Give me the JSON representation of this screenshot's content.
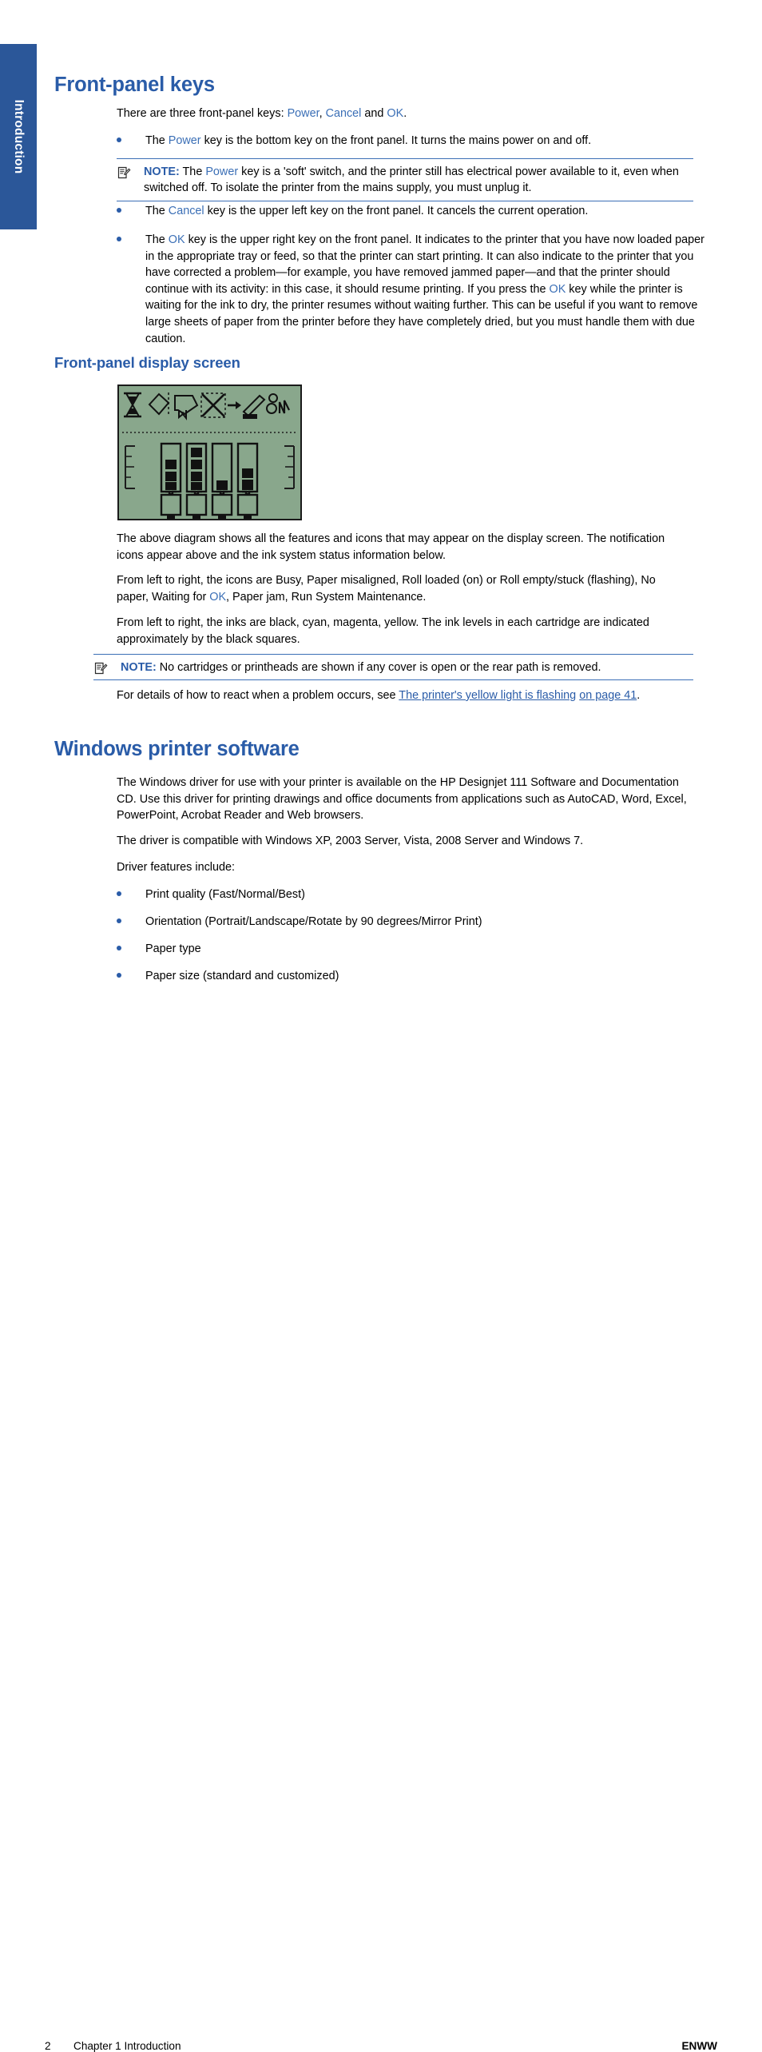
{
  "side_tab": {
    "label": "Introduction"
  },
  "sections": {
    "front_panel_keys": {
      "heading": "Front-panel keys",
      "intro_pre": "There are three front-panel keys: ",
      "intro_power": "Power",
      "intro_comma": ", ",
      "intro_cancel": "Cancel",
      "intro_and": " and ",
      "intro_ok": "OK",
      "intro_end": ".",
      "bullet_power_pre": "The ",
      "bullet_power_key": "Power",
      "bullet_power_post": " key is the bottom key on the front panel. It turns the mains power on and off.",
      "note1_label": "NOTE:",
      "note1_pre": "   The ",
      "note1_key": "Power",
      "note1_post": " key is a 'soft' switch, and the printer still has electrical power available to it, even when switched off. To isolate the printer from the mains supply, you must unplug it.",
      "bullet_cancel_pre": "The ",
      "bullet_cancel_key": "Cancel",
      "bullet_cancel_post": " key is the upper left key on the front panel. It cancels the current operation.",
      "bullet_ok_pre": "The ",
      "bullet_ok_key1": "OK",
      "bullet_ok_mid": " key is the upper right key on the front panel. It indicates to the printer that you have now loaded paper in the appropriate tray or feed, so that the printer can start printing. It can also indicate to the printer that you have corrected a problem—for example, you have removed jammed paper—and that the printer should continue with its activity: in this case, it should resume printing. If you press the ",
      "bullet_ok_key2": "OK",
      "bullet_ok_post": " key while the printer is waiting for the ink to dry, the printer resumes without waiting further. This can be useful if you want to remove large sheets of paper from the printer before they have completely dried, but you must handle them with due caution."
    },
    "front_panel_display": {
      "heading": "Front-panel display screen",
      "para1": "The above diagram shows all the features and icons that may appear on the display screen. The notification icons appear above and the ink system status information below.",
      "para2_pre": "From left to right, the icons are Busy, Paper misaligned, Roll loaded (on) or Roll empty/stuck (flashing), No paper, Waiting for ",
      "para2_ok": "OK",
      "para2_post": ", Paper jam, Run System Maintenance.",
      "para3": "From left to right, the inks are black, cyan, magenta, yellow. The ink levels in each cartridge are indicated approximately by the black squares.",
      "note2_label": "NOTE:",
      "note2_text": "   No cartridges or printheads are shown if any cover is open or the rear path is removed.",
      "xref_pre": "For details of how to react when a problem occurs, see ",
      "xref_link1": "The printer's yellow light is flashing",
      "xref_link2": "on page 41",
      "xref_end": ".",
      "figure": {
        "background_color": "#89a78c",
        "border_color": "#1b1b1b",
        "icons": [
          "busy-hourglass-icon",
          "paper-misaligned-icon",
          "roll-loaded-icon",
          "no-paper-icon",
          "waiting-for-ok-icon",
          "paper-jam-icon",
          "run-system-maintenance-icon"
        ],
        "cartridges": [
          {
            "ink": "black",
            "level_squares": 3
          },
          {
            "ink": "cyan",
            "level_squares": 4
          },
          {
            "ink": "magenta",
            "level_squares": 1
          },
          {
            "ink": "yellow",
            "level_squares": 2
          }
        ]
      }
    },
    "windows_printer_software": {
      "heading": "Windows printer software",
      "para1": "The Windows driver for use with your printer is available on the HP Designjet 111 Software and Documentation CD. Use this driver for printing drawings and office documents from applications such as AutoCAD, Word, Excel, PowerPoint, Acrobat Reader and Web browsers.",
      "para2": "The driver is compatible with Windows XP, 2003 Server, Vista, 2008 Server and Windows 7.",
      "para3": "Driver features include:",
      "features": [
        "Print quality (Fast/Normal/Best)",
        "Orientation (Portrait/Landscape/Rotate by 90 degrees/Mirror Print)",
        "Paper type",
        "Paper size (standard and customized)"
      ]
    }
  },
  "footer": {
    "page_number": "2",
    "chapter": "Chapter 1   Introduction",
    "edition": "ENWW"
  },
  "colors": {
    "heading_blue": "#2a5ca8",
    "link_blue": "#3b6fb6",
    "tab_blue": "#2b5799",
    "lcd_green": "#89a78c"
  }
}
